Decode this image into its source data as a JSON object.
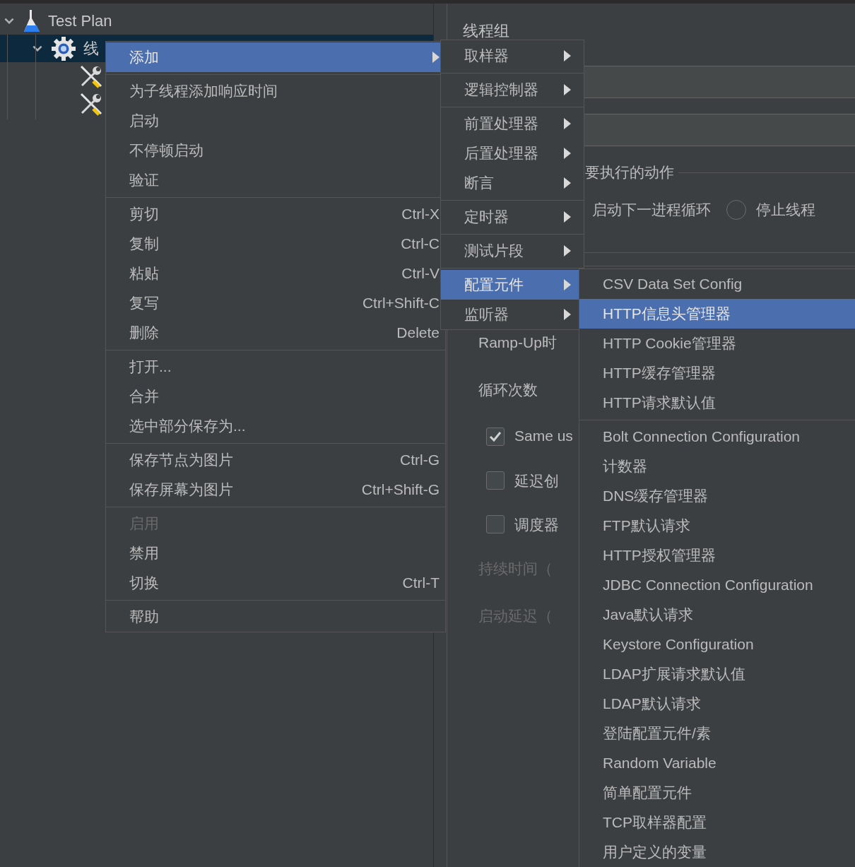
{
  "tree": [
    {
      "kind": "plan",
      "label": "Test Plan",
      "expanded": true,
      "selected": false,
      "children": [
        {
          "kind": "thread-group",
          "label": "线",
          "expanded": true,
          "selected": true,
          "children": [
            {
              "kind": "tool",
              "selected": false
            },
            {
              "kind": "tool",
              "selected": false
            }
          ]
        }
      ]
    }
  ],
  "editor": {
    "title": "线程组",
    "rows": [
      {
        "kind": "field"
      },
      {
        "kind": "field"
      }
    ],
    "action_group": {
      "legend": "要执行的动作",
      "options": [
        {
          "kind": "label",
          "label": "启动下一进程循环"
        },
        {
          "kind": "radio",
          "label": "停止线程",
          "selected": false
        }
      ]
    },
    "settings": [
      {
        "kind": "label",
        "label": "Ramp-Up时",
        "disabled": false
      },
      {
        "kind": "label",
        "label": "循环次数",
        "disabled": false
      },
      {
        "kind": "checkbox",
        "label": "Same us",
        "checked": true
      },
      {
        "kind": "checkbox",
        "label": "延迟创",
        "checked": false
      },
      {
        "kind": "checkbox",
        "label": "调度器",
        "checked": false
      },
      {
        "kind": "label",
        "label": "持续时间（",
        "disabled": true
      },
      {
        "kind": "label",
        "label": "启动延迟（",
        "disabled": true
      }
    ]
  },
  "context_menu": {
    "sections": [
      [
        {
          "label": "添加",
          "submenu": true,
          "selected": true,
          "disabled": false
        }
      ],
      [
        {
          "label": "为子线程添加响应时间",
          "submenu": false,
          "selected": false,
          "disabled": false
        },
        {
          "label": "启动",
          "submenu": false,
          "selected": false,
          "disabled": false
        },
        {
          "label": "不停顿启动",
          "submenu": false,
          "selected": false,
          "disabled": false
        },
        {
          "label": "验证",
          "submenu": false,
          "selected": false,
          "disabled": false
        }
      ],
      [
        {
          "label": "剪切",
          "shortcut": "Ctrl-X",
          "submenu": false,
          "selected": false,
          "disabled": false
        },
        {
          "label": "复制",
          "shortcut": "Ctrl-C",
          "submenu": false,
          "selected": false,
          "disabled": false
        },
        {
          "label": "粘贴",
          "shortcut": "Ctrl-V",
          "submenu": false,
          "selected": false,
          "disabled": false
        },
        {
          "label": "复写",
          "shortcut": "Ctrl+Shift-C",
          "submenu": false,
          "selected": false,
          "disabled": false
        },
        {
          "label": "删除",
          "shortcut": "Delete",
          "submenu": false,
          "selected": false,
          "disabled": false
        }
      ],
      [
        {
          "label": "打开...",
          "submenu": false,
          "selected": false,
          "disabled": false
        },
        {
          "label": "合并",
          "submenu": false,
          "selected": false,
          "disabled": false
        },
        {
          "label": "选中部分保存为...",
          "submenu": false,
          "selected": false,
          "disabled": false
        }
      ],
      [
        {
          "label": "保存节点为图片",
          "shortcut": "Ctrl-G",
          "submenu": false,
          "selected": false,
          "disabled": false
        },
        {
          "label": "保存屏幕为图片",
          "shortcut": "Ctrl+Shift-G",
          "submenu": false,
          "selected": false,
          "disabled": false
        }
      ],
      [
        {
          "label": "启用",
          "submenu": false,
          "selected": false,
          "disabled": true
        },
        {
          "label": "禁用",
          "submenu": false,
          "selected": false,
          "disabled": false
        },
        {
          "label": "切换",
          "shortcut": "Ctrl-T",
          "submenu": false,
          "selected": false,
          "disabled": false
        }
      ],
      [
        {
          "label": "帮助",
          "submenu": false,
          "selected": false,
          "disabled": false
        }
      ]
    ]
  },
  "add_submenu": {
    "sections": [
      [
        {
          "label": "取样器",
          "submenu": true,
          "selected": false
        }
      ],
      [
        {
          "label": "逻辑控制器",
          "submenu": true,
          "selected": false
        }
      ],
      [
        {
          "label": "前置处理器",
          "submenu": true,
          "selected": false
        },
        {
          "label": "后置处理器",
          "submenu": true,
          "selected": false
        },
        {
          "label": "断言",
          "submenu": true,
          "selected": false
        }
      ],
      [
        {
          "label": "定时器",
          "submenu": true,
          "selected": false
        }
      ],
      [
        {
          "label": "测试片段",
          "submenu": true,
          "selected": false
        }
      ],
      [
        {
          "label": "配置元件",
          "submenu": true,
          "selected": true
        },
        {
          "label": "监听器",
          "submenu": true,
          "selected": false
        }
      ]
    ]
  },
  "config_submenu": {
    "sections": [
      [
        {
          "label": "CSV Data Set Config",
          "selected": false
        },
        {
          "label": "HTTP信息头管理器",
          "selected": true
        },
        {
          "label": "HTTP Cookie管理器",
          "selected": false
        },
        {
          "label": "HTTP缓存管理器",
          "selected": false
        },
        {
          "label": "HTTP请求默认值",
          "selected": false
        }
      ],
      [
        {
          "label": "Bolt Connection Configuration",
          "selected": false
        },
        {
          "label": "计数器",
          "selected": false
        },
        {
          "label": "DNS缓存管理器",
          "selected": false
        },
        {
          "label": "FTP默认请求",
          "selected": false
        },
        {
          "label": "HTTP授权管理器",
          "selected": false
        },
        {
          "label": "JDBC Connection Configuration",
          "selected": false
        },
        {
          "label": "Java默认请求",
          "selected": false
        },
        {
          "label": "Keystore Configuration",
          "selected": false
        },
        {
          "label": "LDAP扩展请求默认值",
          "selected": false
        },
        {
          "label": "LDAP默认请求",
          "selected": false
        },
        {
          "label": "登陆配置元件/素",
          "selected": false
        },
        {
          "label": "Random Variable",
          "selected": false
        },
        {
          "label": "简单配置元件",
          "selected": false
        },
        {
          "label": "TCP取样器配置",
          "selected": false
        },
        {
          "label": "用户定义的变量",
          "selected": false
        }
      ]
    ]
  }
}
